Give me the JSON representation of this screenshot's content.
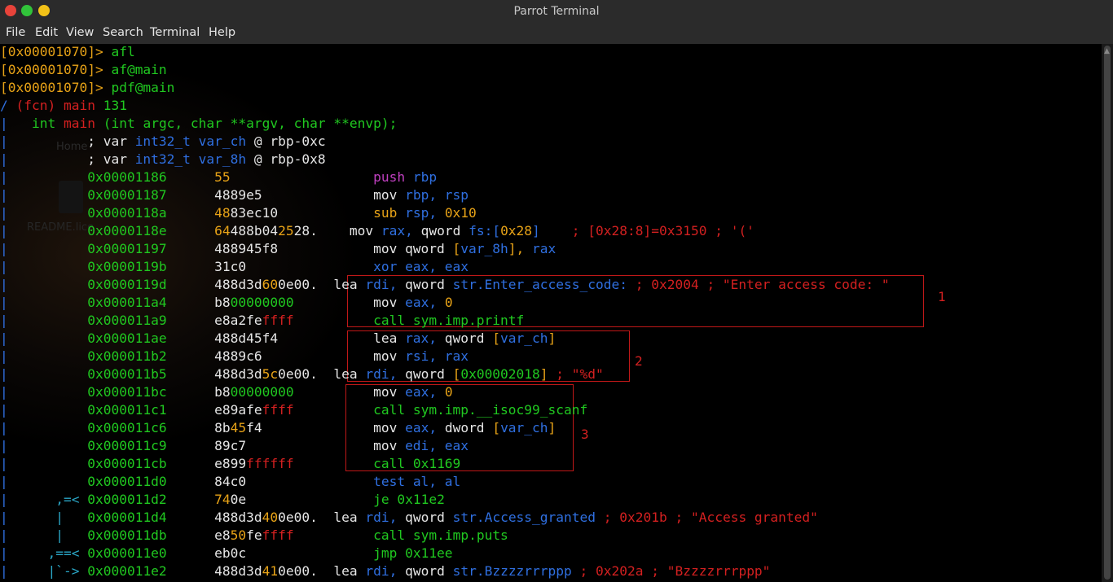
{
  "window": {
    "title": "Parrot Terminal"
  },
  "menu": [
    "File",
    "Edit",
    "View",
    "Search",
    "Terminal",
    "Help"
  ],
  "desktop_bg": {
    "home_label": "Home",
    "file_label": "README.lice"
  },
  "colors": {
    "prompt": "#e8a317",
    "green": "#20c820",
    "red": "#d32020",
    "blue": "#2f6fe0",
    "purple": "#c040c0",
    "white": "#e6e6e6",
    "yellow": "#e8a317",
    "cyan": "#2aa6c6",
    "box": "#c01818"
  },
  "lines": [
    [
      [
        "[0x00001070]> ",
        "yellow"
      ],
      [
        "afl",
        "green"
      ]
    ],
    [
      [
        "[0x00001070]> ",
        "yellow"
      ],
      [
        "af@main",
        "green"
      ]
    ],
    [
      [
        "[0x00001070]> ",
        "yellow"
      ],
      [
        "pdf@main",
        "green"
      ]
    ],
    [
      [
        "/ ",
        "blue"
      ],
      [
        "(fcn) main ",
        "red"
      ],
      [
        "131",
        "green"
      ]
    ],
    [
      [
        "|",
        "blue"
      ],
      [
        "   int ",
        "green"
      ],
      [
        "main ",
        "red"
      ],
      [
        "(int argc, char **argv, char **envp);",
        "green"
      ]
    ],
    [
      [
        "|",
        "blue"
      ],
      [
        "          ; var ",
        "white"
      ],
      [
        "int32_t var_ch ",
        "blue"
      ],
      [
        "@ rbp-0xc",
        "white"
      ]
    ],
    [
      [
        "|",
        "blue"
      ],
      [
        "          ; var ",
        "white"
      ],
      [
        "int32_t var_8h ",
        "blue"
      ],
      [
        "@ rbp-0x8",
        "white"
      ]
    ],
    [
      [
        "|",
        "blue"
      ],
      [
        "          0x00001186",
        "green"
      ],
      [
        "      ",
        "white"
      ],
      [
        "55",
        "yellow"
      ],
      [
        "                  ",
        "white"
      ],
      [
        "push ",
        "purple"
      ],
      [
        "rbp",
        "blue"
      ]
    ],
    [
      [
        "|",
        "blue"
      ],
      [
        "          0x00001187",
        "green"
      ],
      [
        "      ",
        "white"
      ],
      [
        "4889e5",
        "white"
      ],
      [
        "              ",
        "white"
      ],
      [
        "mov ",
        "white"
      ],
      [
        "rbp, rsp",
        "blue"
      ]
    ],
    [
      [
        "|",
        "blue"
      ],
      [
        "          0x0000118a",
        "green"
      ],
      [
        "      ",
        "white"
      ],
      [
        "48",
        "yellow"
      ],
      [
        "83ec10",
        "white"
      ],
      [
        "            ",
        "white"
      ],
      [
        "sub ",
        "yellow"
      ],
      [
        "rsp, ",
        "blue"
      ],
      [
        "0x10",
        "yellow"
      ]
    ],
    [
      [
        "|",
        "blue"
      ],
      [
        "          0x0000118e",
        "green"
      ],
      [
        "      ",
        "white"
      ],
      [
        "64",
        "yellow"
      ],
      [
        "488b04",
        "white"
      ],
      [
        "25",
        "yellow"
      ],
      [
        "28",
        "white"
      ],
      [
        ".",
        "white"
      ],
      [
        "    ",
        "white"
      ],
      [
        "mov ",
        "white"
      ],
      [
        "rax, ",
        "blue"
      ],
      [
        "qword ",
        "white"
      ],
      [
        "fs:[",
        "blue"
      ],
      [
        "0x28",
        "yellow"
      ],
      [
        "]",
        "blue"
      ],
      [
        "    ; [0x28:8]=0x3150 ; '('",
        "red"
      ]
    ],
    [
      [
        "|",
        "blue"
      ],
      [
        "          0x00001197",
        "green"
      ],
      [
        "      ",
        "white"
      ],
      [
        "488945f8",
        "white"
      ],
      [
        "            ",
        "white"
      ],
      [
        "mov ",
        "white"
      ],
      [
        "qword ",
        "white"
      ],
      [
        "[",
        "yellow"
      ],
      [
        "var_8h",
        "blue"
      ],
      [
        "], ",
        "yellow"
      ],
      [
        "rax",
        "blue"
      ]
    ],
    [
      [
        "|",
        "blue"
      ],
      [
        "          0x0000119b",
        "green"
      ],
      [
        "      ",
        "white"
      ],
      [
        "31c0",
        "white"
      ],
      [
        "                ",
        "white"
      ],
      [
        "xor ",
        "blue"
      ],
      [
        "eax, eax",
        "blue"
      ]
    ],
    [
      [
        "|",
        "blue"
      ],
      [
        "          0x0000119d",
        "green"
      ],
      [
        "      ",
        "white"
      ],
      [
        "488d3d",
        "white"
      ],
      [
        "60",
        "yellow"
      ],
      [
        "0e00",
        "white"
      ],
      [
        ".",
        "white"
      ],
      [
        "  ",
        "white"
      ],
      [
        "lea ",
        "white"
      ],
      [
        "rdi, ",
        "blue"
      ],
      [
        "qword ",
        "white"
      ],
      [
        "str.Enter_access_code: ",
        "blue"
      ],
      [
        "; 0x2004 ; \"Enter access code: \"",
        "red"
      ]
    ],
    [
      [
        "|",
        "blue"
      ],
      [
        "          0x000011a4",
        "green"
      ],
      [
        "      ",
        "white"
      ],
      [
        "b8",
        "white"
      ],
      [
        "00000000",
        "green"
      ],
      [
        "          ",
        "white"
      ],
      [
        "mov ",
        "white"
      ],
      [
        "eax, ",
        "blue"
      ],
      [
        "0",
        "yellow"
      ]
    ],
    [
      [
        "|",
        "blue"
      ],
      [
        "          0x000011a9",
        "green"
      ],
      [
        "      ",
        "white"
      ],
      [
        "e8a2fe",
        "white"
      ],
      [
        "ffff",
        "red"
      ],
      [
        "          ",
        "white"
      ],
      [
        "call ",
        "green"
      ],
      [
        "sym.imp.printf",
        "green"
      ]
    ],
    [
      [
        "|",
        "blue"
      ],
      [
        "          0x000011ae",
        "green"
      ],
      [
        "      ",
        "white"
      ],
      [
        "488d45f4",
        "white"
      ],
      [
        "            ",
        "white"
      ],
      [
        "lea ",
        "white"
      ],
      [
        "rax, ",
        "blue"
      ],
      [
        "qword ",
        "white"
      ],
      [
        "[",
        "yellow"
      ],
      [
        "var_ch",
        "blue"
      ],
      [
        "]",
        "yellow"
      ]
    ],
    [
      [
        "|",
        "blue"
      ],
      [
        "          0x000011b2",
        "green"
      ],
      [
        "      ",
        "white"
      ],
      [
        "4889c6",
        "white"
      ],
      [
        "              ",
        "white"
      ],
      [
        "mov ",
        "white"
      ],
      [
        "rsi, rax",
        "blue"
      ]
    ],
    [
      [
        "|",
        "blue"
      ],
      [
        "          0x000011b5",
        "green"
      ],
      [
        "      ",
        "white"
      ],
      [
        "488d3d",
        "white"
      ],
      [
        "5c",
        "yellow"
      ],
      [
        "0e00",
        "white"
      ],
      [
        ".",
        "white"
      ],
      [
        "  ",
        "white"
      ],
      [
        "lea ",
        "white"
      ],
      [
        "rdi, ",
        "blue"
      ],
      [
        "qword ",
        "white"
      ],
      [
        "[",
        "yellow"
      ],
      [
        "0x00002018",
        "green"
      ],
      [
        "] ",
        "yellow"
      ],
      [
        "; \"%d\"",
        "red"
      ]
    ],
    [
      [
        "|",
        "blue"
      ],
      [
        "          0x000011bc",
        "green"
      ],
      [
        "      ",
        "white"
      ],
      [
        "b8",
        "white"
      ],
      [
        "00000000",
        "green"
      ],
      [
        "          ",
        "white"
      ],
      [
        "mov ",
        "white"
      ],
      [
        "eax, ",
        "blue"
      ],
      [
        "0",
        "yellow"
      ]
    ],
    [
      [
        "|",
        "blue"
      ],
      [
        "          0x000011c1",
        "green"
      ],
      [
        "      ",
        "white"
      ],
      [
        "e89afe",
        "white"
      ],
      [
        "ffff",
        "red"
      ],
      [
        "          ",
        "white"
      ],
      [
        "call ",
        "green"
      ],
      [
        "sym.imp.__isoc99_scanf",
        "green"
      ]
    ],
    [
      [
        "|",
        "blue"
      ],
      [
        "          0x000011c6",
        "green"
      ],
      [
        "      ",
        "white"
      ],
      [
        "8b",
        "white"
      ],
      [
        "45",
        "yellow"
      ],
      [
        "f4",
        "white"
      ],
      [
        "              ",
        "white"
      ],
      [
        "mov ",
        "white"
      ],
      [
        "eax, ",
        "blue"
      ],
      [
        "dword ",
        "white"
      ],
      [
        "[",
        "yellow"
      ],
      [
        "var_ch",
        "blue"
      ],
      [
        "]",
        "yellow"
      ]
    ],
    [
      [
        "|",
        "blue"
      ],
      [
        "          0x000011c9",
        "green"
      ],
      [
        "      ",
        "white"
      ],
      [
        "89c7",
        "white"
      ],
      [
        "                ",
        "white"
      ],
      [
        "mov ",
        "white"
      ],
      [
        "edi, eax",
        "blue"
      ]
    ],
    [
      [
        "|",
        "blue"
      ],
      [
        "          0x000011cb",
        "green"
      ],
      [
        "      ",
        "white"
      ],
      [
        "e899",
        "white"
      ],
      [
        "ffffff",
        "red"
      ],
      [
        "          ",
        "white"
      ],
      [
        "call ",
        "green"
      ],
      [
        "0x1169",
        "green"
      ]
    ],
    [
      [
        "|",
        "blue"
      ],
      [
        "          0x000011d0",
        "green"
      ],
      [
        "      ",
        "white"
      ],
      [
        "84c0",
        "white"
      ],
      [
        "                ",
        "white"
      ],
      [
        "test ",
        "blue"
      ],
      [
        "al, al",
        "blue"
      ]
    ],
    [
      [
        "|",
        "blue"
      ],
      [
        "      ,=< ",
        "cyan"
      ],
      [
        "0x000011d2",
        "green"
      ],
      [
        "      ",
        "white"
      ],
      [
        "74",
        "yellow"
      ],
      [
        "0e",
        "white"
      ],
      [
        "                ",
        "white"
      ],
      [
        "je ",
        "green"
      ],
      [
        "0x11e2",
        "green"
      ]
    ],
    [
      [
        "|",
        "blue"
      ],
      [
        "      |   ",
        "cyan"
      ],
      [
        "0x000011d4",
        "green"
      ],
      [
        "      ",
        "white"
      ],
      [
        "488d3d",
        "white"
      ],
      [
        "40",
        "yellow"
      ],
      [
        "0e00",
        "white"
      ],
      [
        ".",
        "white"
      ],
      [
        "  ",
        "white"
      ],
      [
        "lea ",
        "white"
      ],
      [
        "rdi, ",
        "blue"
      ],
      [
        "qword ",
        "white"
      ],
      [
        "str.Access_granted ",
        "blue"
      ],
      [
        "; 0x201b ; \"Access granted\"",
        "red"
      ]
    ],
    [
      [
        "|",
        "blue"
      ],
      [
        "      |   ",
        "cyan"
      ],
      [
        "0x000011db",
        "green"
      ],
      [
        "      ",
        "white"
      ],
      [
        "e8",
        "white"
      ],
      [
        "50",
        "yellow"
      ],
      [
        "fe",
        "white"
      ],
      [
        "ffff",
        "red"
      ],
      [
        "          ",
        "white"
      ],
      [
        "call ",
        "green"
      ],
      [
        "sym.imp.puts",
        "green"
      ]
    ],
    [
      [
        "|",
        "blue"
      ],
      [
        "     ,==< ",
        "cyan"
      ],
      [
        "0x000011e0",
        "green"
      ],
      [
        "      ",
        "white"
      ],
      [
        "eb0c",
        "white"
      ],
      [
        "                ",
        "white"
      ],
      [
        "jmp ",
        "green"
      ],
      [
        "0x11ee",
        "green"
      ]
    ],
    [
      [
        "|",
        "blue"
      ],
      [
        "     |`-> ",
        "cyan"
      ],
      [
        "0x000011e2",
        "green"
      ],
      [
        "      ",
        "white"
      ],
      [
        "488d3d",
        "white"
      ],
      [
        "41",
        "yellow"
      ],
      [
        "0e00",
        "white"
      ],
      [
        ".",
        "white"
      ],
      [
        "  ",
        "white"
      ],
      [
        "lea ",
        "white"
      ],
      [
        "rdi, ",
        "blue"
      ],
      [
        "qword ",
        "white"
      ],
      [
        "str.Bzzzzrrrppp ",
        "blue"
      ],
      [
        "; 0x202a ; \"Bzzzzrrrppp\"",
        "red"
      ]
    ]
  ],
  "annotations": {
    "box1": {
      "label": "1"
    },
    "box2": {
      "label": "2"
    },
    "box3": {
      "label": "3"
    }
  }
}
